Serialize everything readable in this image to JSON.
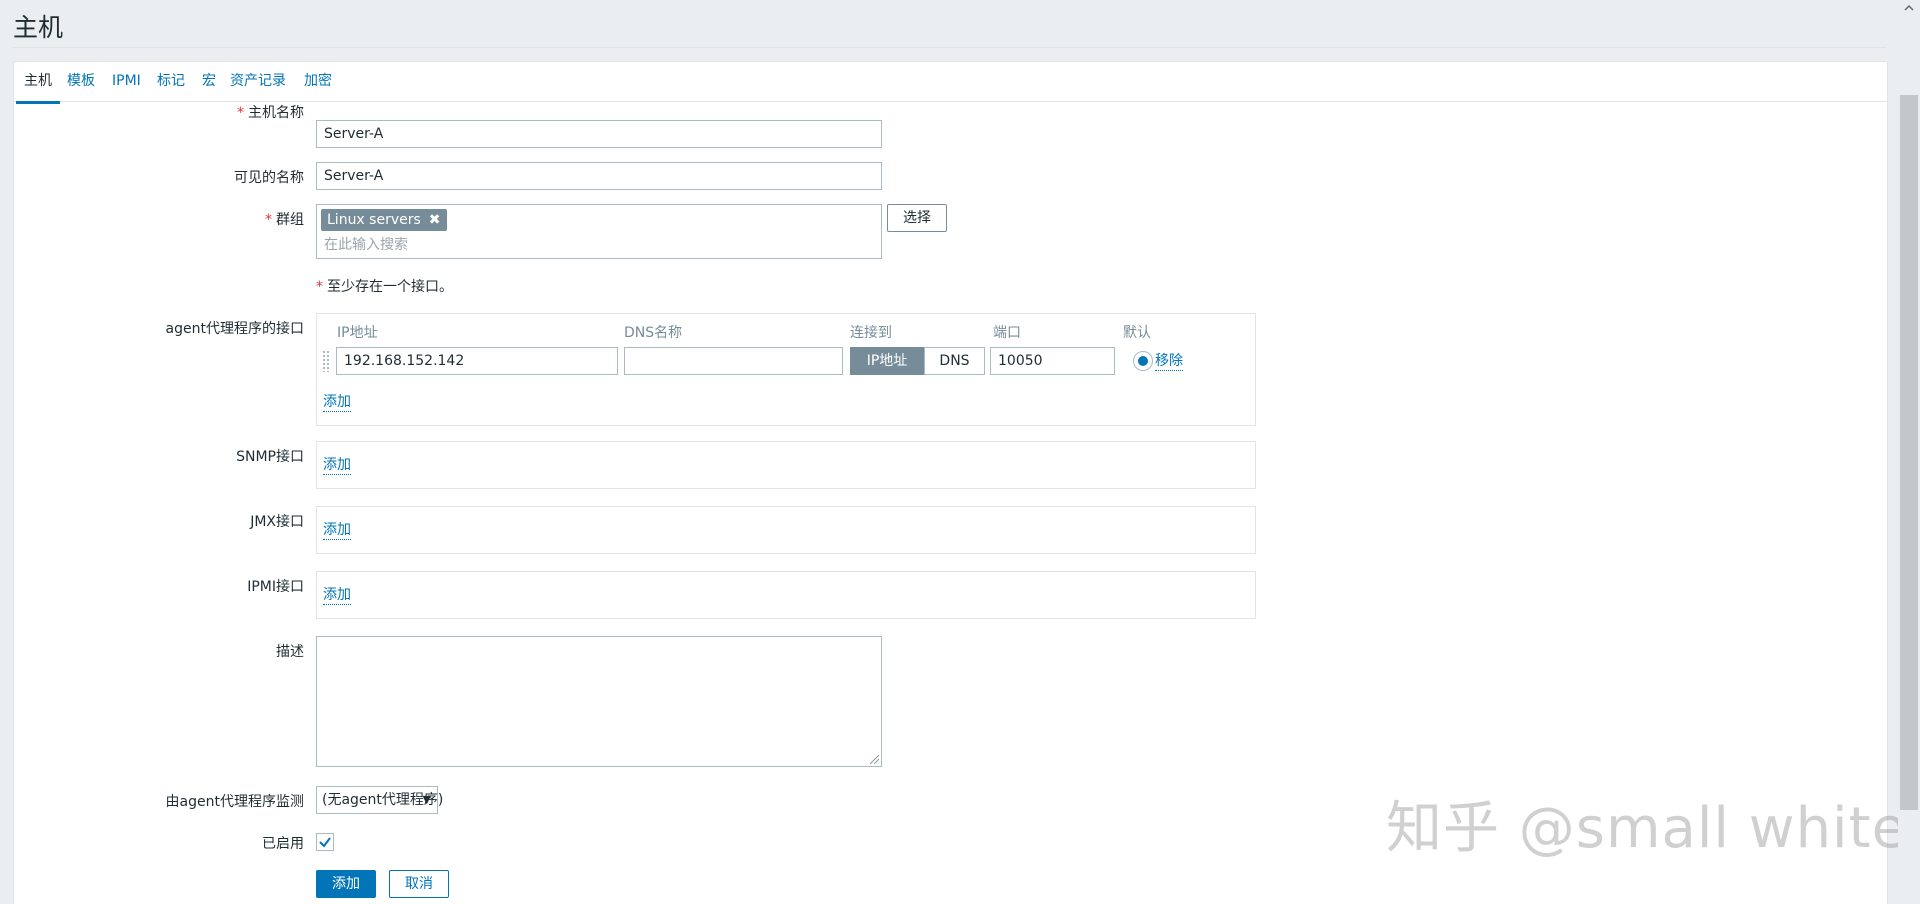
{
  "page": {
    "title": "主机"
  },
  "tabs": [
    {
      "label": "主机"
    },
    {
      "label": "模板"
    },
    {
      "label": "IPMI"
    },
    {
      "label": "标记"
    },
    {
      "label": "宏"
    },
    {
      "label": "资产记录"
    },
    {
      "label": "加密"
    }
  ],
  "form": {
    "hostname": {
      "label": "主机名称",
      "value": "Server-A"
    },
    "visible_name": {
      "label": "可见的名称",
      "value": "Server-A"
    },
    "groups": {
      "label": "群组",
      "chip": "Linux servers",
      "placeholder": "在此输入搜索",
      "select_button": "选择"
    },
    "interface_hint": "至少存在一个接口。",
    "agent": {
      "label": "agent代理程序的接口",
      "columns": {
        "ip": "IP地址",
        "dns": "DNS名称",
        "connect": "连接到",
        "port": "端口",
        "default": "默认"
      },
      "row": {
        "ip": "192.168.152.142",
        "dns": "",
        "connect_ip": "IP地址",
        "connect_dns": "DNS",
        "port": "10050",
        "remove": "移除"
      },
      "add": "添加"
    },
    "snmp": {
      "label": "SNMP接口",
      "add": "添加"
    },
    "jmx": {
      "label": "JMX接口",
      "add": "添加"
    },
    "ipmi": {
      "label": "IPMI接口",
      "add": "添加"
    },
    "description": {
      "label": "描述",
      "value": ""
    },
    "monitored_by": {
      "label": "由agent代理程序监测",
      "value": "(无agent代理程序)"
    },
    "enabled": {
      "label": "已启用",
      "checked": true
    },
    "buttons": {
      "add": "添加",
      "cancel": "取消"
    }
  },
  "watermark": "知乎 @small white",
  "colors": {
    "accent": "#0275b8",
    "required": "#e33734"
  }
}
